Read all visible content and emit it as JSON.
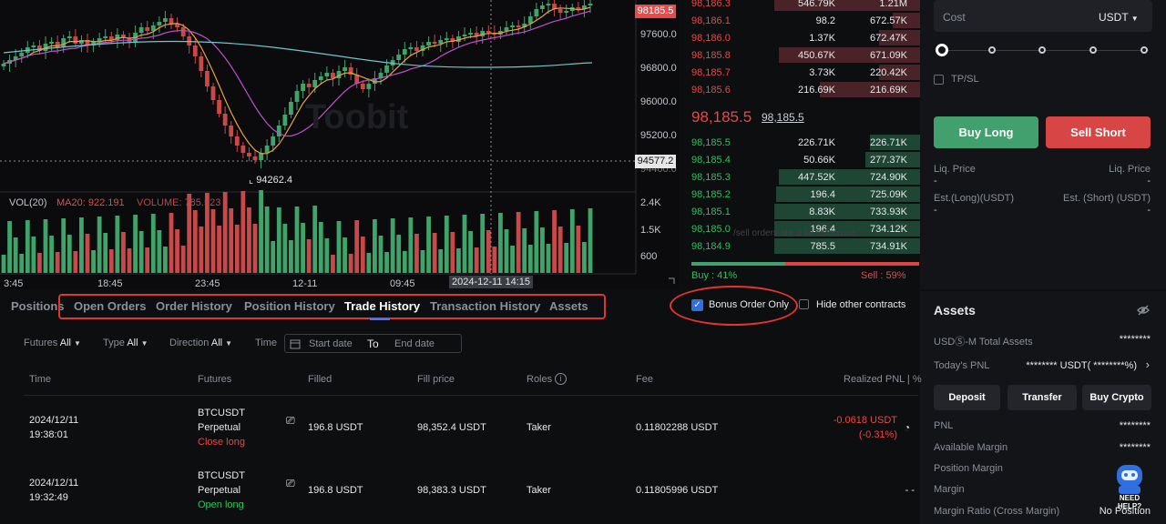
{
  "chart": {
    "y_labels": [
      "97600.0",
      "96800.0",
      "96000.0",
      "95200.0",
      "94400.0"
    ],
    "price_tag_top": "98185.5",
    "price_tag_cross": "94577.2",
    "low_label": "94262.4",
    "x_labels": [
      "3:45",
      "18:45",
      "23:45",
      "12-11",
      "09:45"
    ],
    "crosshair_time": "2024-12-11 14:15",
    "vol_title": "VOL(20)",
    "ma_label": "MA20: 922.191",
    "volume_label": "VOLUME: 785.523",
    "vol_y_labels": [
      "2.4K",
      "1.5K",
      "600"
    ],
    "watermark": "Toobit"
  },
  "orderbook": {
    "asks": [
      {
        "price": "98,186.3",
        "qty": "546.79K",
        "total": "1.21M"
      },
      {
        "price": "98,186.1",
        "qty": "98.2",
        "total": "672.57K"
      },
      {
        "price": "98,186.0",
        "qty": "1.37K",
        "total": "672.47K"
      },
      {
        "price": "98,185.8",
        "qty": "450.67K",
        "total": "671.09K"
      },
      {
        "price": "98,185.7",
        "qty": "3.73K",
        "total": "220.42K"
      },
      {
        "price": "98,185.6",
        "qty": "216.69K",
        "total": "216.69K"
      }
    ],
    "last_price": "98,185.5",
    "mark_price": "98,185.5",
    "bids": [
      {
        "price": "98,185.5",
        "qty": "226.71K",
        "total": "226.71K"
      },
      {
        "price": "98,185.4",
        "qty": "50.66K",
        "total": "277.37K"
      },
      {
        "price": "98,185.3",
        "qty": "447.52K",
        "total": "724.90K"
      },
      {
        "price": "98,185.2",
        "qty": "196.4",
        "total": "725.09K"
      },
      {
        "price": "98,185.1",
        "qty": "8.83K",
        "total": "733.93K"
      },
      {
        "price": "98,185.0",
        "qty": "196.4",
        "total": "734.12K"
      },
      {
        "price": "98,184.9",
        "qty": "785.5",
        "total": "734.91K"
      }
    ],
    "buy_label": "Buy :",
    "buy_pct": "41%",
    "sell_label": "Sell :",
    "sell_pct": "59%",
    "note": "/sell orders are       d for reference",
    "buy_fraction": 0.41
  },
  "order_panel": {
    "cost_label": "Cost",
    "cost_unit": "USDT",
    "tpsl_label": "TP/SL",
    "buy_long": "Buy Long",
    "sell_short": "Sell Short",
    "liq_price": "Liq. Price",
    "liq_price_val": "-",
    "liq_price_right": "Liq. Price",
    "liq_price_right_val": "-",
    "est_long": "Est.(Long)(USDT)",
    "est_long_val": "-",
    "est_short": "Est. (Short) (USDT)",
    "est_short_val": "-",
    "colors": {
      "buy": "#41a06e",
      "sell": "#d84545"
    }
  },
  "assets": {
    "title": "Assets",
    "total_label": "USDⓈ-M Total Assets",
    "total_val": "********",
    "pnl_label": "Today's PNL",
    "pnl_val": "******** USDT( ********%)",
    "deposit": "Deposit",
    "transfer": "Transfer",
    "buy_crypto": "Buy Crypto",
    "rows": [
      {
        "label": "PNL",
        "value": "********"
      },
      {
        "label": "Available Margin",
        "value": "********"
      },
      {
        "label": "Position Margin",
        "value": ""
      },
      {
        "label": "Margin",
        "value": ""
      },
      {
        "label": "Margin Ratio (Cross Margin)",
        "value": "No Position"
      }
    ],
    "help_text": "NEED HELP?"
  },
  "tabs": {
    "items": [
      "Positions",
      "Open Orders",
      "Order History",
      "Position History",
      "Trade History",
      "Transaction History",
      "Assets"
    ],
    "active": "Trade History",
    "bonus_only": "Bonus Order Only",
    "hide_other": "Hide other contracts"
  },
  "filters": {
    "futures_label": "Futures",
    "futures_val": "All",
    "type_label": "Type",
    "type_val": "All",
    "direction_label": "Direction",
    "direction_val": "All",
    "time_label": "Time",
    "start_date": "Start date",
    "to": "To",
    "end_date": "End date"
  },
  "table": {
    "headers": [
      "Time",
      "Futures",
      "Filled",
      "Fill price",
      "Roles",
      "Fee",
      "Realized PNL | %"
    ],
    "rows": [
      {
        "date": "2024/12/11",
        "time": "19:38:01",
        "symbol": "BTCUSDT",
        "kind": "Perpetual",
        "side": "Close long",
        "filled": "196.8 USDT",
        "fill_price": "98,352.4 USDT",
        "role": "Taker",
        "fee": "0.11802288 USDT",
        "pnl": "-0.0618 USDT",
        "pnl_pct": "(-0.31%)"
      },
      {
        "date": "2024/12/11",
        "time": "19:32:49",
        "symbol": "BTCUSDT",
        "kind": "Perpetual",
        "side": "Open long",
        "filled": "196.8 USDT",
        "fill_price": "98,383.3 USDT",
        "role": "Taker",
        "fee": "0.11805996 USDT",
        "pnl": "- -",
        "pnl_pct": ""
      }
    ]
  }
}
